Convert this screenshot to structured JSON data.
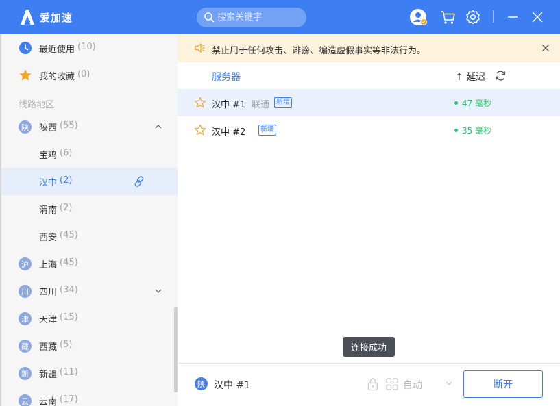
{
  "app": {
    "title": "爱加速",
    "brand_color": "#3d7ef2"
  },
  "header": {
    "search": {
      "placeholder": "搜索关键字",
      "value": "",
      "icon": "search-icon"
    },
    "icons": [
      "user-avatar-icon",
      "cart-icon",
      "gear-icon",
      "minimize-icon",
      "close-icon"
    ]
  },
  "sidebar": {
    "top_items": [
      {
        "label": "最近使用",
        "count": "(10)",
        "icon": "clock-icon"
      },
      {
        "label": "我的收藏",
        "count": "(0)",
        "icon": "star-icon"
      }
    ],
    "section_title": "线路地区",
    "regions": [
      {
        "badge": "陕",
        "label": "陕西",
        "count": "(55)",
        "expanded": true,
        "children": [
          {
            "label": "宝鸡",
            "count": "(6)"
          },
          {
            "label": "汉中",
            "count": "(2)",
            "selected": true
          },
          {
            "label": "渭南",
            "count": "(2)"
          },
          {
            "label": "西安",
            "count": "(45)"
          }
        ]
      },
      {
        "badge": "沪",
        "label": "上海",
        "count": "(45)"
      },
      {
        "badge": "川",
        "label": "四川",
        "count": "(34)",
        "expandable": true
      },
      {
        "badge": "津",
        "label": "天津",
        "count": "(15)"
      },
      {
        "badge": "藏",
        "label": "西藏",
        "count": "(5)"
      },
      {
        "badge": "新",
        "label": "新疆",
        "count": "(11)"
      },
      {
        "badge": "云",
        "label": "云南",
        "count": "(17)"
      }
    ]
  },
  "notice": {
    "text": "禁止用于任何攻击、诽谤、编造虚假事实等非法行为。",
    "background": "#fdf3dc"
  },
  "server_list": {
    "columns": {
      "server": "服务器",
      "latency": "延迟",
      "sort_arrow": "↑"
    },
    "rows": [
      {
        "name": "汉中 #1",
        "isp": "联通",
        "tag": "新增",
        "latency": "47 毫秒",
        "active": true
      },
      {
        "name": "汉中 #2",
        "isp": "",
        "tag": "新增",
        "latency": "35 毫秒",
        "active": false
      }
    ],
    "latency_color": "#2cbf6a"
  },
  "toast": {
    "text": "连接成功"
  },
  "bottom_bar": {
    "region_badge": "陕",
    "current_server": "汉中 #1",
    "mode": "自动",
    "disconnect_label": "断开"
  }
}
